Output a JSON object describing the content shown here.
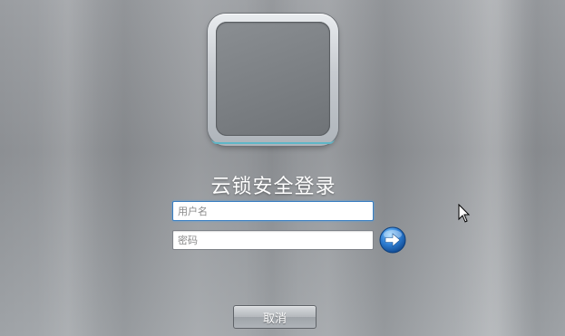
{
  "login": {
    "title": "云锁安全登录",
    "username_placeholder": "用户名",
    "password_placeholder": "密码",
    "cancel_label": "取消"
  },
  "icons": {
    "submit": "arrow-right-icon",
    "pointer": "mouse-cursor-icon"
  },
  "colors": {
    "accent": "#2f7fd4",
    "focus_border": "#3a7fc2"
  }
}
